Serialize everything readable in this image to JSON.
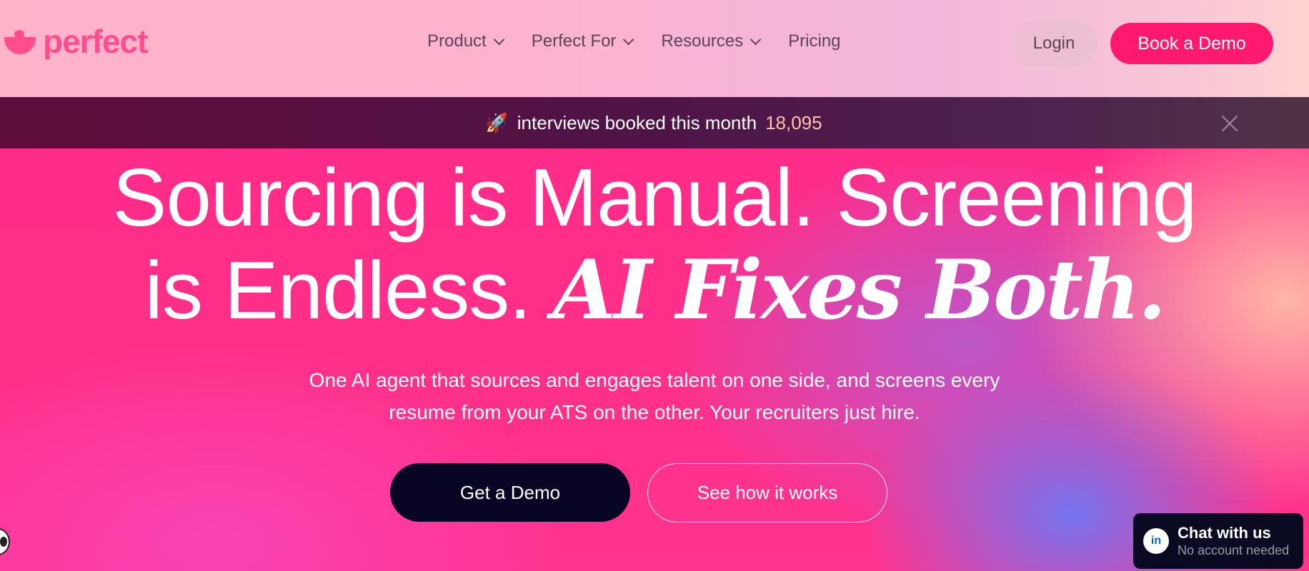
{
  "header": {
    "logo_text": "perfect",
    "nav": [
      {
        "label": "Product",
        "has_dropdown": true
      },
      {
        "label": "Perfect For",
        "has_dropdown": true
      },
      {
        "label": "Resources",
        "has_dropdown": true
      },
      {
        "label": "Pricing",
        "has_dropdown": false
      }
    ],
    "login_label": "Login",
    "book_demo_label": "Book a Demo"
  },
  "banner": {
    "icon": "rocket-icon",
    "text": "interviews booked this month",
    "count": "18,095"
  },
  "hero": {
    "title_line1": "Sourcing is Manual. Screening",
    "title_line2_plain": "is Endless.",
    "title_line2_italic": "AI Fixes Both.",
    "subtitle_line1": "One AI agent that sources and engages talent on one side, and screens every",
    "subtitle_line2": "resume from your ATS on the other. Your recruiters just hire.",
    "cta_primary": "Get a Demo",
    "cta_secondary": "See how it works"
  },
  "chat_widget": {
    "icon": "linkedin-icon",
    "icon_label": "in",
    "title": "Chat with us",
    "subtitle": "No account needed"
  },
  "colors": {
    "brand_pink": "#ff1a70",
    "banner_bg": "#4f1447",
    "banner_count": "#ffc2a8",
    "cta_dark": "#080624"
  }
}
